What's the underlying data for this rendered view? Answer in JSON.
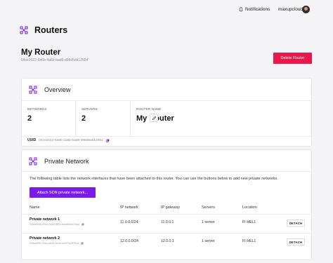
{
  "topbar": {
    "notifications_label": "Notifications",
    "username": "maxupcloud"
  },
  "page": {
    "title": "Routers"
  },
  "router": {
    "name": "My Router",
    "id": "04ce2022-9a6b-4a6b-bad6-d98d5dd12554",
    "delete_label": "Delete Router"
  },
  "overview": {
    "title": "Overview",
    "networks_label": "NETWORKS",
    "networks_value": "2",
    "servers_label": "SERVERS",
    "servers_value": "2",
    "router_name_label": "ROUTER NAME",
    "router_name_value": "My Router",
    "uuid_label": "UUID",
    "uuid_value": "04ce2022-9a6b-4a6b-bad6-d98d5dd12554"
  },
  "private_network": {
    "title": "Private Network",
    "description": "The following table lists the network interfaces that have been attached to this router. You can use the buttons below to add new private networks.",
    "attach_label": "Attach SDN private network...",
    "columns": [
      "Name",
      "IP network",
      "IP gateway",
      "Servers",
      "Location"
    ],
    "rows": [
      {
        "name": "Private network 1",
        "uuid": "035d61d6-57bc-4c46-9f60-6dc890ea7da4",
        "ip_network": "11.0.0.0/24",
        "ip_gateway": "11.0.0.1",
        "servers": "1 server",
        "location": "FI-HEL1",
        "action": "DETACH"
      },
      {
        "name": "Private network 2",
        "uuid": "035d89f3-72a0-4023-9b4b-de979c6f7516",
        "ip_network": "12.0.0.0/24",
        "ip_gateway": "12.0.0.1",
        "servers": "1 server",
        "location": "FI-HEL1",
        "action": "DETACH"
      }
    ]
  },
  "colors": {
    "accent": "#7a1ce6",
    "danger": "#e8184d"
  },
  "icons": {
    "router": "router-nodes-icon",
    "bell": "bell-icon",
    "edit": "pencil-icon",
    "copy": "copy-icon"
  }
}
